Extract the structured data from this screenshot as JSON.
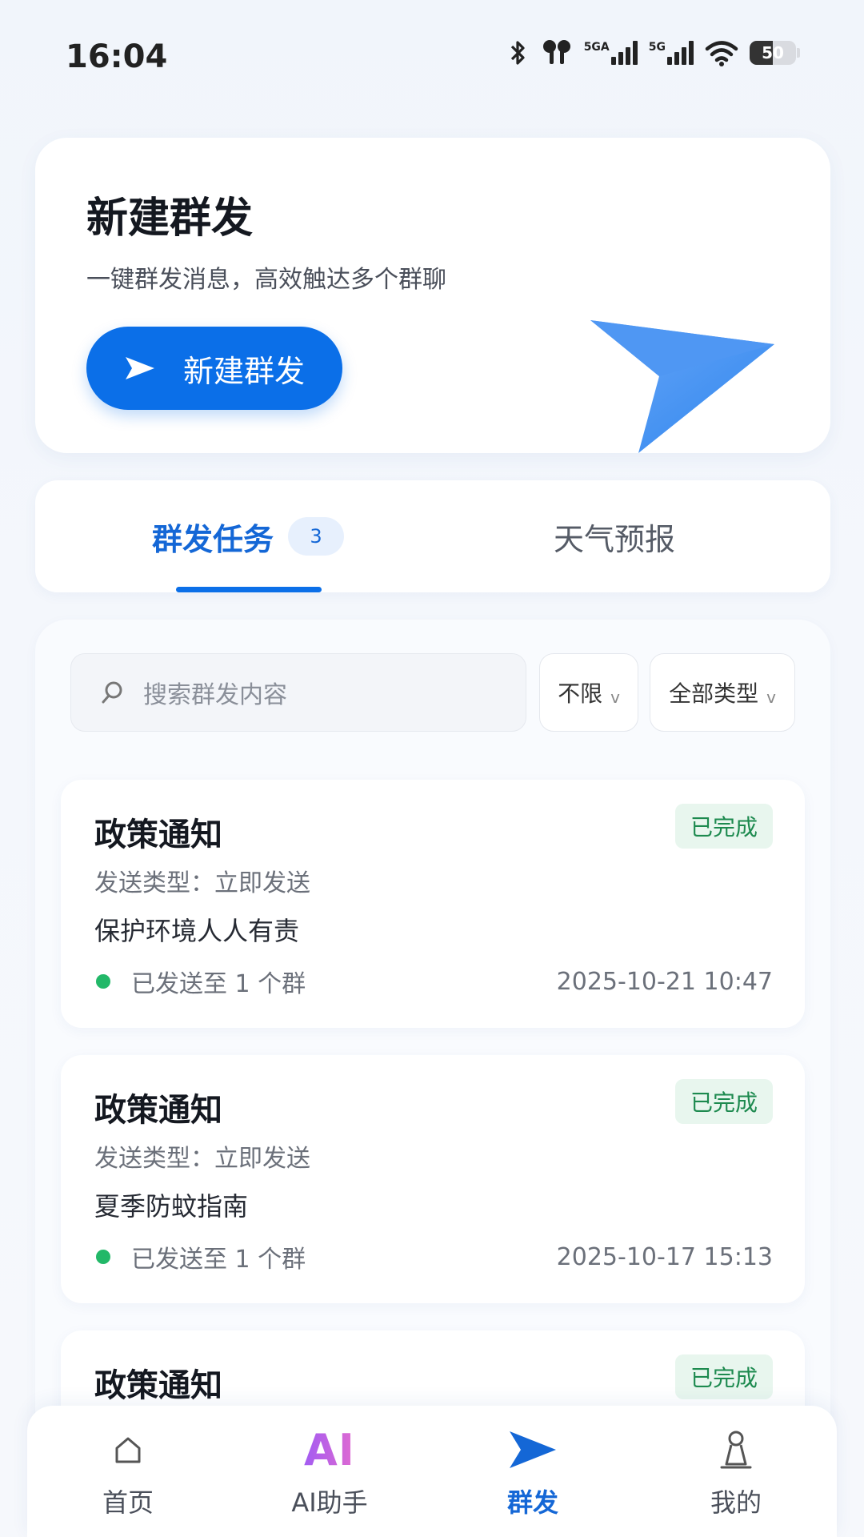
{
  "status_bar": {
    "time": "16:04",
    "net1_label": "5GA",
    "net2_label": "5G",
    "battery_level": "50",
    "battery_fraction": 0.5
  },
  "hero": {
    "title": "新建群发",
    "subtitle": "一键群发消息，高效触达多个群聊",
    "button_label": "新建群发"
  },
  "tabs": {
    "active_label": "群发任务",
    "active_count": "3",
    "second_label": "天气预报"
  },
  "filters": {
    "search_placeholder": "搜索群发内容",
    "time_filter": "不限",
    "type_filter": "全部类型",
    "chevron": "v"
  },
  "tasks": [
    {
      "title": "政策通知",
      "status": "已完成",
      "type": "发送类型：立即发送",
      "content": "保护环境人人有责",
      "sent": "已发送至 1 个群",
      "time": "2025-10-21 10:47"
    },
    {
      "title": "政策通知",
      "status": "已完成",
      "type": "发送类型：立即发送",
      "content": "夏季防蚊指南",
      "sent": "已发送至 1 个群",
      "time": "2025-10-17 15:13"
    },
    {
      "title": "政策通知",
      "status": "已完成"
    }
  ],
  "bottom_nav": {
    "items": [
      {
        "label": "首页",
        "icon": "home-icon"
      },
      {
        "label": "AI助手",
        "icon": "ai-icon",
        "icon_text": "AI"
      },
      {
        "label": "群发",
        "icon": "send-icon"
      },
      {
        "label": "我的",
        "icon": "user-icon"
      }
    ],
    "active_index": 2
  },
  "colors": {
    "primary": "#0b6fe8",
    "success": "#22b868",
    "badge_bg": "#e8f6ee",
    "ai_gradient": [
      "#a35cf2",
      "#e06ad1"
    ]
  }
}
